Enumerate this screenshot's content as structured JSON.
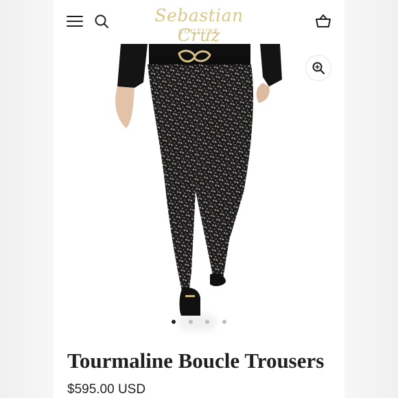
{
  "header": {
    "logo_main": "Sebastian Cruz",
    "logo_sub": "COUTURE",
    "icons": {
      "menu": "hamburger-menu-icon",
      "search": "search-icon",
      "cart": "basket-icon",
      "zoom": "zoom-in-icon"
    }
  },
  "gallery": {
    "slides": 4,
    "active_slide": 1
  },
  "product": {
    "title": "Tourmaline Boucle Trousers",
    "price": "$595.00 USD"
  },
  "colors": {
    "logo_gold": "#d8c88a",
    "text": "#1f1f1f",
    "dot_active": "#222222",
    "dot_inactive": "#bdbdbd"
  }
}
